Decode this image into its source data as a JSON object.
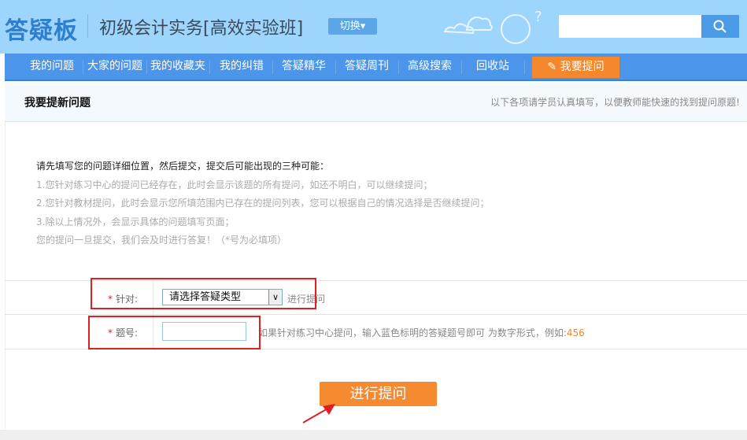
{
  "header": {
    "logo": "答疑板",
    "course": "初级会计实务[高效实验班]",
    "switch": "切换▾",
    "search_value": ""
  },
  "nav": {
    "items": [
      "我的问题",
      "大家的问题",
      "我的收藏夹",
      "我的纠错",
      "答疑精华",
      "答疑周刊",
      "高级搜索",
      "回收站"
    ],
    "ask": "我要提问"
  },
  "sub": {
    "title": "我要提新问题",
    "hint": "以下各项请学员认真填写，以便教师能快速的找到提问原题!"
  },
  "intro": {
    "lines": [
      "请先填写您的问题详细位置，然后提交，提交后可能出现的三种可能：",
      "1.您针对练习中心的提问已经存在，此时会显示该题的所有提问，如还不明白，可以继续提问；",
      "2.您针对教材提问，此时会显示您所填范围内已存在的提问列表，您可以根据自己的情况选择是否继续提问；",
      "3.除以上情况外，会显示具体的问题填写页面；",
      "您的提问一旦提交，我们会及时进行答复！（*号为必填项）"
    ]
  },
  "form": {
    "star": "*",
    "target_label": "针对:",
    "target_select": "请选择答疑类型",
    "target_suffix": "进行提问",
    "qno_label": "题号:",
    "qno_value": "",
    "qno_hint": "如果针对练习中心提问，输入蓝色标明的答疑题号即可 为数字形式，例如:",
    "qno_example": "456"
  },
  "submit": "进行提问",
  "colors": {
    "nav": "#4b95ea",
    "accent": "#f58a30",
    "header": "#9ed5fc"
  }
}
